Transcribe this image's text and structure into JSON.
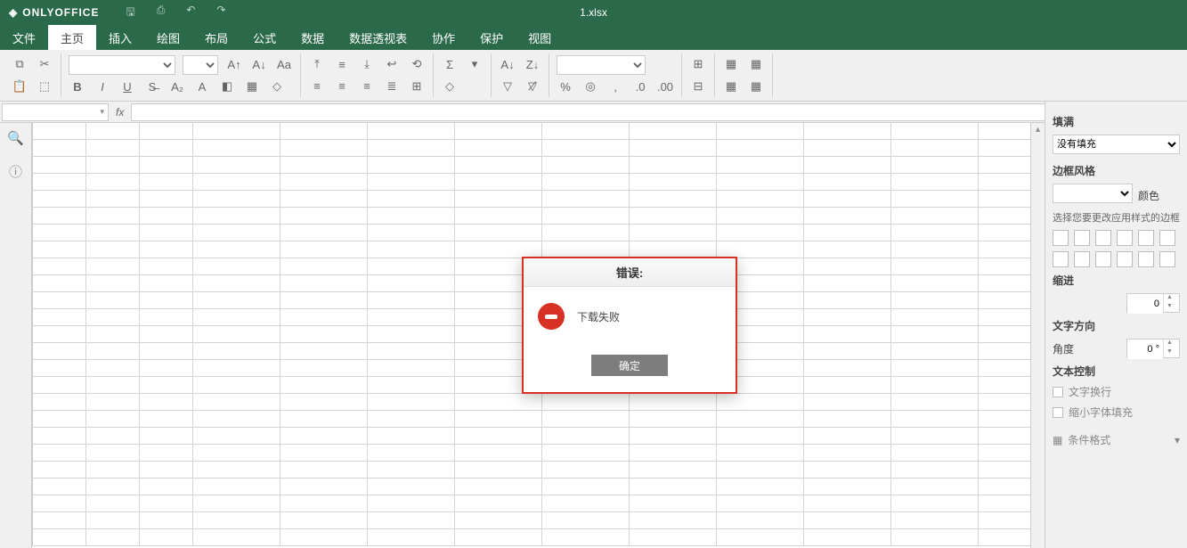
{
  "app": {
    "name": "ONLYOFFICE",
    "file_title": "1.xlsx"
  },
  "menu": {
    "tabs": [
      "文件",
      "主页",
      "插入",
      "绘图",
      "布局",
      "公式",
      "数据",
      "数据透视表",
      "协作",
      "保护",
      "视图"
    ],
    "active_index": 1
  },
  "right_panel": {
    "fill_title": "填满",
    "fill_value": "没有填充",
    "border_style_title": "边框风格",
    "border_color_label": "颜色",
    "border_hint": "选择您要更改应用样式的边框",
    "indent_title": "缩进",
    "indent_value": "0",
    "text_dir_title": "文字方向",
    "angle_label": "角度",
    "angle_value": "0 °",
    "text_control_title": "文本控制",
    "wrap_label": "文字换行",
    "shrink_label": "缩小字体填充",
    "cond_format_label": "条件格式"
  },
  "dialog": {
    "title": "错误:",
    "message": "下载失败",
    "ok": "确定"
  }
}
